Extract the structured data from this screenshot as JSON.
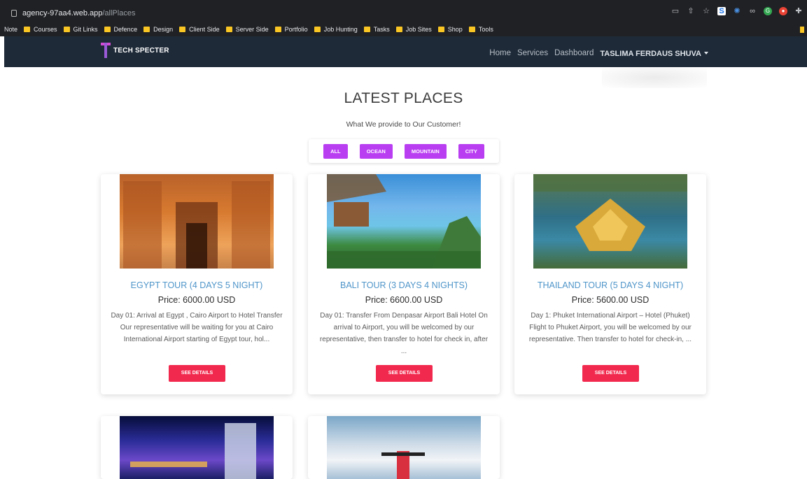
{
  "browser": {
    "url_host": "agency-97aa4.web.app",
    "url_path": "/allPlaces",
    "bookmarks": [
      "Note",
      "Courses",
      "Git Links",
      "Defence",
      "Design",
      "Client Side",
      "Server Side",
      "Portfolio",
      "Job Hunting",
      "Tasks",
      "Job Sites",
      "Shop",
      "Tools"
    ]
  },
  "navbar": {
    "brand": "TECH SPECTER",
    "links": [
      "Home",
      "Services",
      "Dashboard"
    ],
    "user": "TASLIMA FERDAUS SHUVA"
  },
  "section": {
    "title": "LATEST PLACES",
    "subtitle": "What We provide to Our Customer!",
    "filters": [
      "ALL",
      "OCEAN",
      "MOUNTAIN",
      "CITY"
    ]
  },
  "cards": [
    {
      "title": "EGYPT TOUR (4 DAYS 5 NIGHT)",
      "price": "Price: 6000.00 USD",
      "desc": "Day 01: Arrival at Egypt , Cairo Airport to Hotel Transfer Our representative will be waiting for you at Cairo International Airport starting of Egypt tour, hol...",
      "button": "SEE DETAILS"
    },
    {
      "title": "BALI TOUR (3 DAYS 4 NIGHTS)",
      "price": "Price: 6600.00 USD",
      "desc": "Day 01: Transfer From Denpasar Airport Bali Hotel On arrival to Airport, you will be welcomed by our representative, then transfer to hotel for check in, after ...",
      "button": "SEE DETAILS"
    },
    {
      "title": "THAILAND TOUR (5 DAYS 4 NIGHT)",
      "price": "Price: 5600.00 USD",
      "desc": "Day 1: Phuket International Airport – Hotel (Phuket) Flight to Phuket Airport, you will be welcomed by our representative. Then transfer to hotel for check-in, ...",
      "button": "SEE DETAILS"
    }
  ]
}
